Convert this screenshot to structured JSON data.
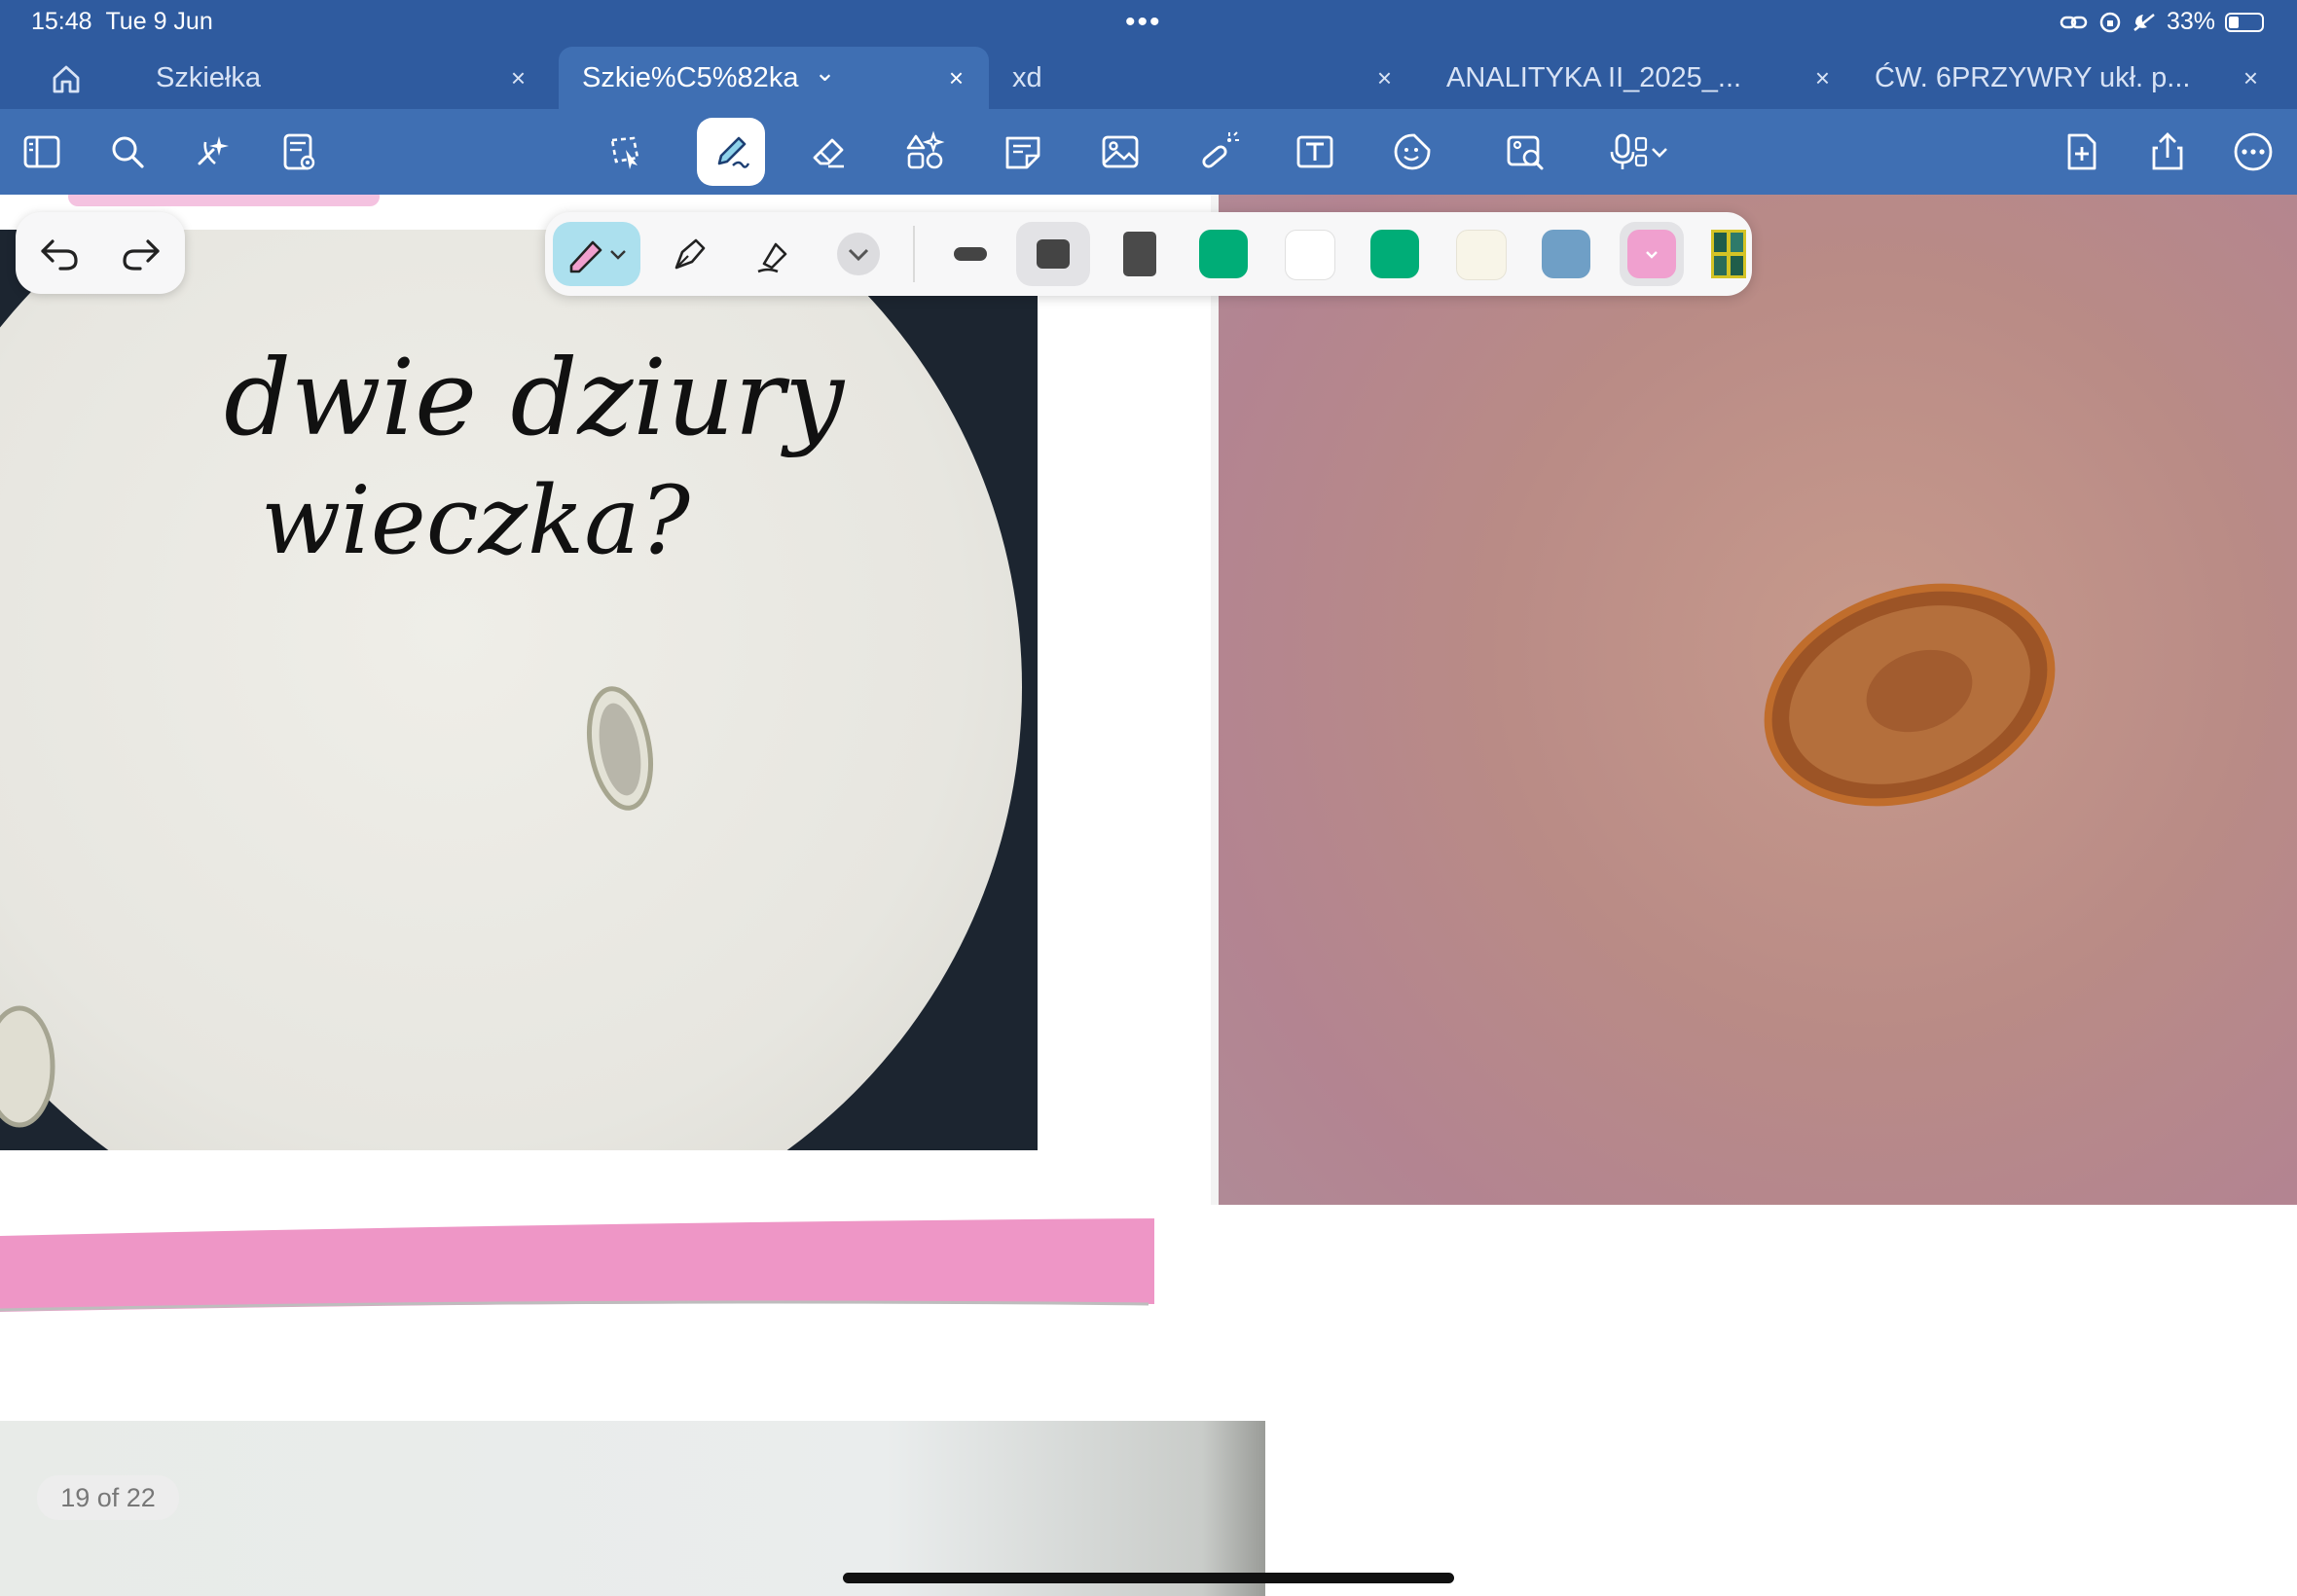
{
  "status_bar": {
    "time": "15:48",
    "date": "Tue 9 Jun",
    "dots": "•••",
    "battery": "33%"
  },
  "tabs": [
    {
      "label": "Szkiełka",
      "active": false
    },
    {
      "label": "Szkie%C5%82ka",
      "active": true
    },
    {
      "label": "xd",
      "active": false
    },
    {
      "label": "ANALITYKA II_2025_...",
      "active": false
    },
    {
      "label": "ĆW. 6PRZYWRY ukł. p...",
      "active": false
    }
  ],
  "tab_close": "×",
  "tab_active_chevron": "⌄",
  "toolbar_icons": [
    "sidebar-icon",
    "search-icon",
    "ai-sparkle-icon",
    "document-reader-icon",
    "lasso-select-icon",
    "pen-icon",
    "eraser-icon",
    "shapes-icon",
    "sticky-note-icon",
    "image-icon",
    "laser-pointer-icon",
    "text-box-icon",
    "sticker-icon",
    "image-search-icon",
    "microphone-icon",
    "new-page-icon",
    "share-icon",
    "more-icon"
  ],
  "pen_palette": {
    "colors": [
      "#555555",
      "#505050",
      "#4a4a4a",
      "#00ad77",
      "#ffffff",
      "#00ad77",
      "#f8f5e8",
      "#6f9fc6",
      "#f0a0cf"
    ],
    "selected_color": "#f0a0cf"
  },
  "handwriting": {
    "line1": "dwie dziury",
    "line2": "wieczka?"
  },
  "page_counter": "19 of 22",
  "colors": {
    "app_blue": "#2f5b9f",
    "toolbar_blue": "#3f6fb3",
    "highlight_pink": "#ee96c6"
  }
}
